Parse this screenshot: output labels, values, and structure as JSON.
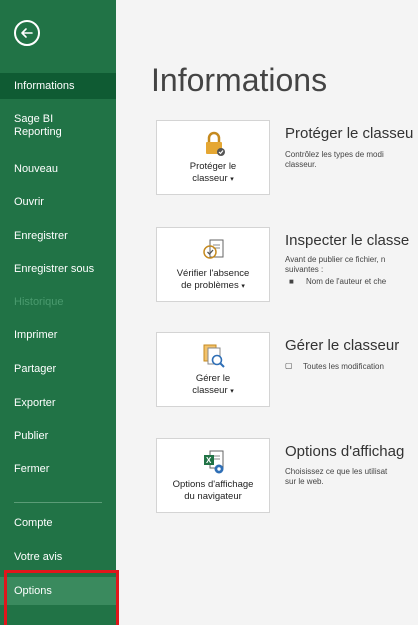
{
  "sidebar": {
    "items": [
      {
        "label": "Informations"
      },
      {
        "label": "Sage BI Reporting"
      },
      {
        "label": "Nouveau"
      },
      {
        "label": "Ouvrir"
      },
      {
        "label": "Enregistrer"
      },
      {
        "label": "Enregistrer sous"
      },
      {
        "label": "Historique"
      },
      {
        "label": "Imprimer"
      },
      {
        "label": "Partager"
      },
      {
        "label": "Exporter"
      },
      {
        "label": "Publier"
      },
      {
        "label": "Fermer"
      },
      {
        "label": "Compte"
      },
      {
        "label": "Votre avis"
      },
      {
        "label": "Options"
      }
    ]
  },
  "main": {
    "title": "Informations",
    "sections": [
      {
        "button_line1": "Protéger le",
        "button_line2": "classeur",
        "title": "Protéger le classeu",
        "desc_line1": "Contrôlez les types de modi",
        "desc_line2": "classeur."
      },
      {
        "button_line1": "Vérifier l'absence",
        "button_line2": "de problèmes",
        "title": "Inspecter le classe",
        "desc_line1": "Avant de publier ce fichier, n",
        "desc_line2": "suivantes :",
        "bullet": "Nom de l'auteur et che"
      },
      {
        "button_line1": "Gérer le",
        "button_line2": "classeur",
        "title": "Gérer le classeur",
        "bullet": "Toutes les modification"
      },
      {
        "button_line1": "Options d'affichage",
        "button_line2": "du navigateur",
        "title": "Options d'affichag",
        "desc_line1": "Choisissez ce que les utilisat",
        "desc_line2": "sur le web."
      }
    ]
  },
  "colors": {
    "sidebar": "#217346",
    "sidebar_active": "#0f5b33",
    "highlight": "#e0161b"
  }
}
